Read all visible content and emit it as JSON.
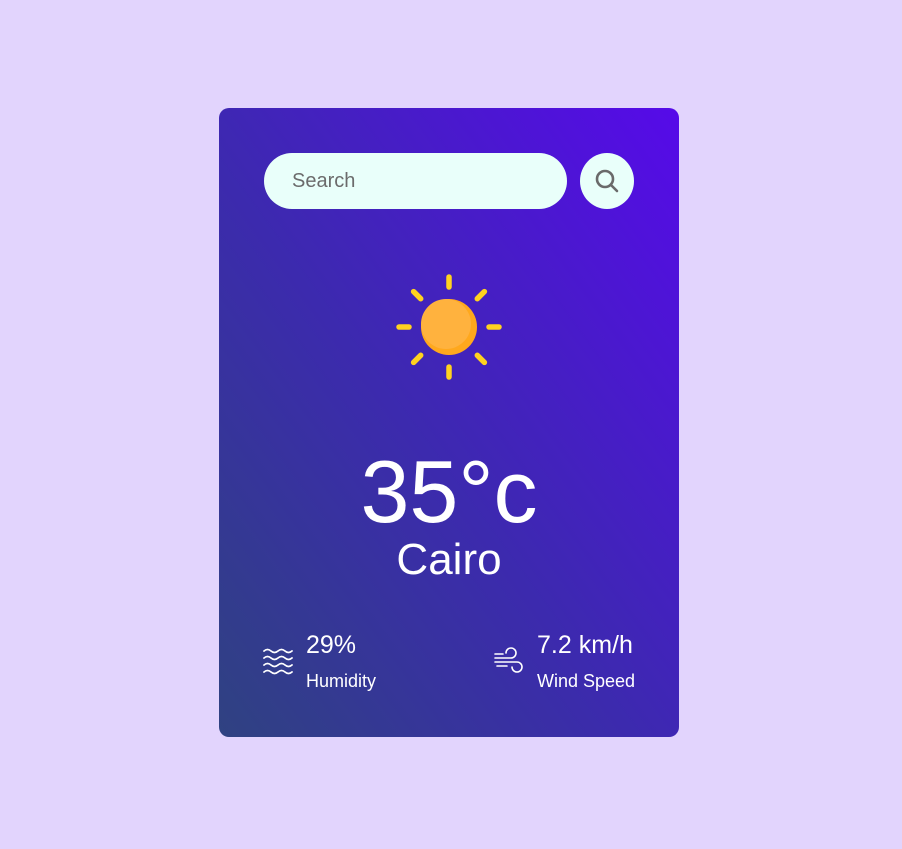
{
  "search": {
    "placeholder": "Search",
    "value": "",
    "button_icon": "search-icon"
  },
  "weather": {
    "icon": "sun-icon",
    "temperature": "35°c",
    "city": "Cairo"
  },
  "details": {
    "humidity": {
      "icon": "humidity-waves-icon",
      "value": "29%",
      "label": "Humidity"
    },
    "wind": {
      "icon": "wind-icon",
      "value": "7.2 km/h",
      "label": "Wind Speed"
    }
  },
  "colors": {
    "page_background": "#e2d4fd",
    "card_gradient_start": "#2f4281",
    "card_gradient_end": "#560ae9",
    "search_background": "#e9fffa",
    "sun_body": "#ffaf38",
    "sun_rays": "#ffd21f"
  }
}
